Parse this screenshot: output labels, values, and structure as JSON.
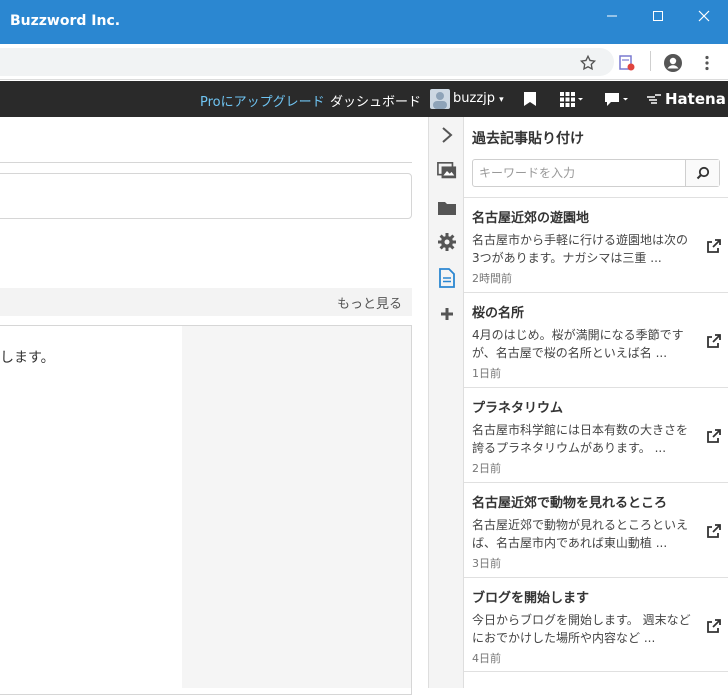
{
  "window": {
    "title": "Buzzword Inc."
  },
  "hatena_bar": {
    "upgrade": "Proにアップグレード",
    "dashboard": "ダッシュボード",
    "username": "buzzjp",
    "logo": "Hatena"
  },
  "editor": {
    "more_link": "もっと見る",
    "partial_text": "します。"
  },
  "icon_column": [
    "chevron-right-icon",
    "image-icon",
    "folder-icon",
    "gear-icon",
    "document-icon",
    "plus-icon"
  ],
  "panel": {
    "title": "過去記事貼り付け",
    "search_placeholder": "キーワードを入力",
    "articles": [
      {
        "title": "名古屋近郊の遊園地",
        "excerpt": "名古屋市から手軽に行ける遊園地は次の3つがあります。ナガシマは三重 ...",
        "time": "2時間前"
      },
      {
        "title": "桜の名所",
        "excerpt": "4月のはじめ。桜が満開になる季節ですが、名古屋で桜の名所といえば名 ...",
        "time": "1日前"
      },
      {
        "title": "プラネタリウム",
        "excerpt": "名古屋市科学館には日本有数の大きさを誇るプラネタリウムがあります。 ...",
        "time": "2日前"
      },
      {
        "title": "名古屋近郊で動物を見れるところ",
        "excerpt": "名古屋近郊で動物が見れるところといえば、名古屋市内であれば東山動植 ...",
        "time": "3日前"
      },
      {
        "title": "ブログを開始します",
        "excerpt": "今日からブログを開始します。 週末などにおでかけした場所や内容など ...",
        "time": "4日前"
      }
    ]
  },
  "colors": {
    "titlebar": "#2b87d1",
    "hatena_bar": "#2a2a2a",
    "upgrade_link": "#6fc4f2",
    "active_icon": "#2b87d1"
  }
}
